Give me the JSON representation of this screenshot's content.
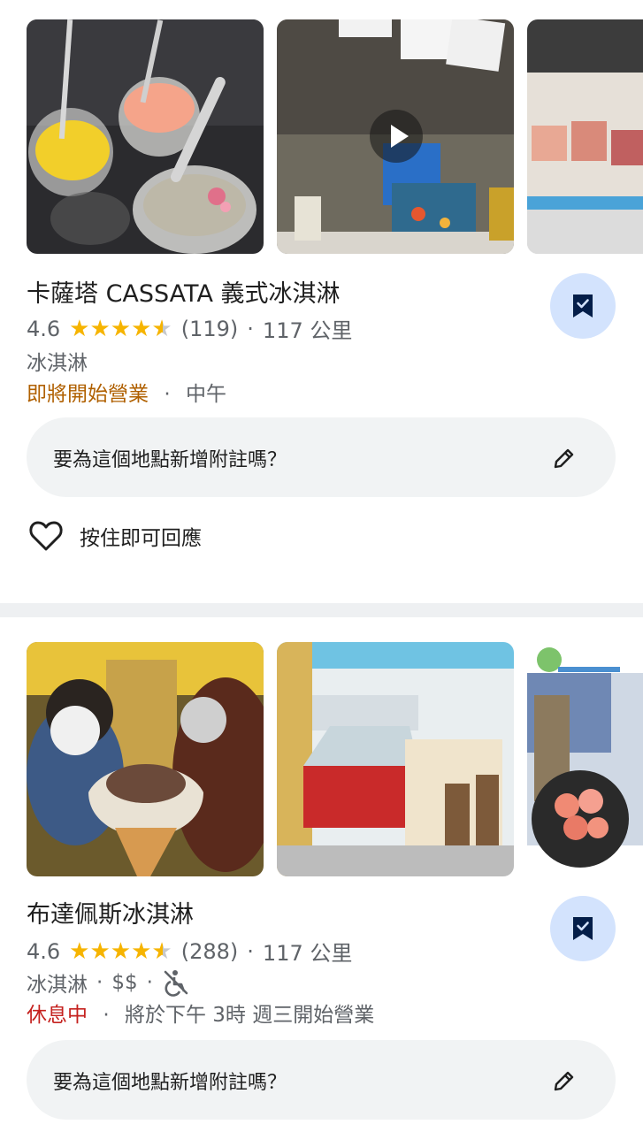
{
  "places": [
    {
      "name": "卡薩塔 CASSATA 義式冰淇淋",
      "rating": "4.6",
      "rating_value": 4.6,
      "reviews": "(119)",
      "distance": "117 公里",
      "category": "冰淇淋",
      "status": "即將開始營業",
      "status_detail": "中午",
      "note_prompt": "要為這個地點新增附註嗎？",
      "like_label": "按住即可回應",
      "photos": [
        "ice-cream-cups-photo",
        "shop-interior-video",
        "ice-cream-display-photo"
      ]
    },
    {
      "name": "布達佩斯冰淇淋",
      "rating": "4.6",
      "rating_value": 4.6,
      "reviews": "(288)",
      "distance": "117 公里",
      "category": "冰淇淋",
      "price": "$$",
      "status": "休息中",
      "status_detail": "將於下午 3時 週三開始營業",
      "note_prompt": "要為這個地點新增附註嗎？",
      "photos": [
        "couple-ice-cream-cone-photo",
        "gelato-freezer-interior-photo",
        "budapest-collage-photo"
      ]
    }
  ],
  "separator": "·",
  "colors": {
    "star": "#f6b400",
    "opening_soon": "#b06000",
    "closed": "#c5221f",
    "save_button_bg": "#d3e3fd",
    "save_icon": "#041e49"
  },
  "icons": {
    "save": "bookmark-check-icon",
    "edit": "pencil-icon",
    "like": "heart-outline-icon",
    "accessibility": "no-wheelchair-icon",
    "video": "play-icon"
  }
}
